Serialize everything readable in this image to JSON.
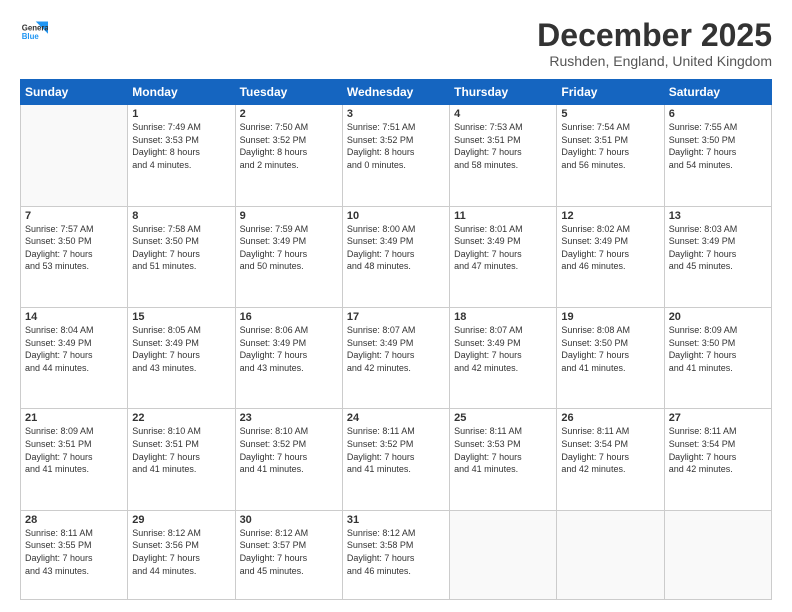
{
  "logo": {
    "line1": "General",
    "line2": "Blue"
  },
  "title": "December 2025",
  "location": "Rushden, England, United Kingdom",
  "headers": [
    "Sunday",
    "Monday",
    "Tuesday",
    "Wednesday",
    "Thursday",
    "Friday",
    "Saturday"
  ],
  "weeks": [
    [
      {
        "date": "",
        "info": ""
      },
      {
        "date": "1",
        "info": "Sunrise: 7:49 AM\nSunset: 3:53 PM\nDaylight: 8 hours\nand 4 minutes."
      },
      {
        "date": "2",
        "info": "Sunrise: 7:50 AM\nSunset: 3:52 PM\nDaylight: 8 hours\nand 2 minutes."
      },
      {
        "date": "3",
        "info": "Sunrise: 7:51 AM\nSunset: 3:52 PM\nDaylight: 8 hours\nand 0 minutes."
      },
      {
        "date": "4",
        "info": "Sunrise: 7:53 AM\nSunset: 3:51 PM\nDaylight: 7 hours\nand 58 minutes."
      },
      {
        "date": "5",
        "info": "Sunrise: 7:54 AM\nSunset: 3:51 PM\nDaylight: 7 hours\nand 56 minutes."
      },
      {
        "date": "6",
        "info": "Sunrise: 7:55 AM\nSunset: 3:50 PM\nDaylight: 7 hours\nand 54 minutes."
      }
    ],
    [
      {
        "date": "7",
        "info": "Sunrise: 7:57 AM\nSunset: 3:50 PM\nDaylight: 7 hours\nand 53 minutes."
      },
      {
        "date": "8",
        "info": "Sunrise: 7:58 AM\nSunset: 3:50 PM\nDaylight: 7 hours\nand 51 minutes."
      },
      {
        "date": "9",
        "info": "Sunrise: 7:59 AM\nSunset: 3:49 PM\nDaylight: 7 hours\nand 50 minutes."
      },
      {
        "date": "10",
        "info": "Sunrise: 8:00 AM\nSunset: 3:49 PM\nDaylight: 7 hours\nand 48 minutes."
      },
      {
        "date": "11",
        "info": "Sunrise: 8:01 AM\nSunset: 3:49 PM\nDaylight: 7 hours\nand 47 minutes."
      },
      {
        "date": "12",
        "info": "Sunrise: 8:02 AM\nSunset: 3:49 PM\nDaylight: 7 hours\nand 46 minutes."
      },
      {
        "date": "13",
        "info": "Sunrise: 8:03 AM\nSunset: 3:49 PM\nDaylight: 7 hours\nand 45 minutes."
      }
    ],
    [
      {
        "date": "14",
        "info": "Sunrise: 8:04 AM\nSunset: 3:49 PM\nDaylight: 7 hours\nand 44 minutes."
      },
      {
        "date": "15",
        "info": "Sunrise: 8:05 AM\nSunset: 3:49 PM\nDaylight: 7 hours\nand 43 minutes."
      },
      {
        "date": "16",
        "info": "Sunrise: 8:06 AM\nSunset: 3:49 PM\nDaylight: 7 hours\nand 43 minutes."
      },
      {
        "date": "17",
        "info": "Sunrise: 8:07 AM\nSunset: 3:49 PM\nDaylight: 7 hours\nand 42 minutes."
      },
      {
        "date": "18",
        "info": "Sunrise: 8:07 AM\nSunset: 3:49 PM\nDaylight: 7 hours\nand 42 minutes."
      },
      {
        "date": "19",
        "info": "Sunrise: 8:08 AM\nSunset: 3:50 PM\nDaylight: 7 hours\nand 41 minutes."
      },
      {
        "date": "20",
        "info": "Sunrise: 8:09 AM\nSunset: 3:50 PM\nDaylight: 7 hours\nand 41 minutes."
      }
    ],
    [
      {
        "date": "21",
        "info": "Sunrise: 8:09 AM\nSunset: 3:51 PM\nDaylight: 7 hours\nand 41 minutes."
      },
      {
        "date": "22",
        "info": "Sunrise: 8:10 AM\nSunset: 3:51 PM\nDaylight: 7 hours\nand 41 minutes."
      },
      {
        "date": "23",
        "info": "Sunrise: 8:10 AM\nSunset: 3:52 PM\nDaylight: 7 hours\nand 41 minutes."
      },
      {
        "date": "24",
        "info": "Sunrise: 8:11 AM\nSunset: 3:52 PM\nDaylight: 7 hours\nand 41 minutes."
      },
      {
        "date": "25",
        "info": "Sunrise: 8:11 AM\nSunset: 3:53 PM\nDaylight: 7 hours\nand 41 minutes."
      },
      {
        "date": "26",
        "info": "Sunrise: 8:11 AM\nSunset: 3:54 PM\nDaylight: 7 hours\nand 42 minutes."
      },
      {
        "date": "27",
        "info": "Sunrise: 8:11 AM\nSunset: 3:54 PM\nDaylight: 7 hours\nand 42 minutes."
      }
    ],
    [
      {
        "date": "28",
        "info": "Sunrise: 8:11 AM\nSunset: 3:55 PM\nDaylight: 7 hours\nand 43 minutes."
      },
      {
        "date": "29",
        "info": "Sunrise: 8:12 AM\nSunset: 3:56 PM\nDaylight: 7 hours\nand 44 minutes."
      },
      {
        "date": "30",
        "info": "Sunrise: 8:12 AM\nSunset: 3:57 PM\nDaylight: 7 hours\nand 45 minutes."
      },
      {
        "date": "31",
        "info": "Sunrise: 8:12 AM\nSunset: 3:58 PM\nDaylight: 7 hours\nand 46 minutes."
      },
      {
        "date": "",
        "info": ""
      },
      {
        "date": "",
        "info": ""
      },
      {
        "date": "",
        "info": ""
      }
    ]
  ]
}
